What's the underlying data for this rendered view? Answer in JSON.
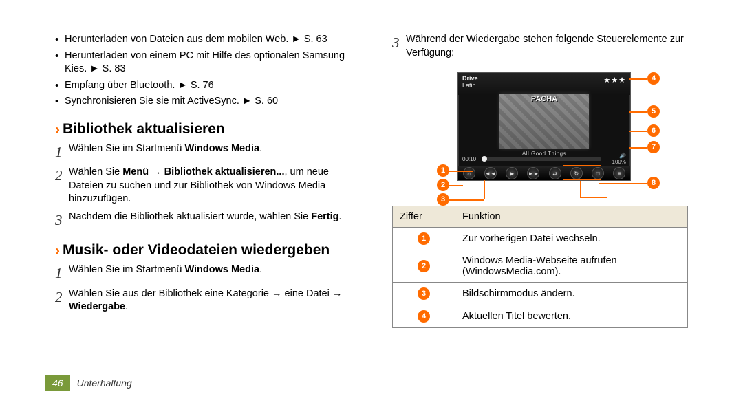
{
  "left": {
    "bullets": [
      {
        "pre": "Herunterladen von Dateien aus dem mobilen Web. ► ",
        "ref": "S. 63"
      },
      {
        "pre": "Herunterladen von einem PC mit Hilfe des optionalen Samsung Kies. ► ",
        "ref": "S. 83"
      },
      {
        "pre": "Empfang über Bluetooth. ► ",
        "ref": "S. 76"
      },
      {
        "pre": "Synchronisieren Sie sie mit ActiveSync. ► ",
        "ref": "S. 60"
      }
    ],
    "heading1": "Bibliothek aktualisieren",
    "steps1": [
      {
        "n": "1",
        "pre": "Wählen Sie im Startmenü ",
        "b1": "Windows Media",
        "post": "."
      },
      {
        "n": "2",
        "pre": "Wählen Sie ",
        "b1": "Menü",
        "mid": " → ",
        "b2": "Bibliothek aktualisieren...",
        "post": ", um neue Dateien zu suchen und zur Bibliothek von Windows Media hinzuzufügen."
      },
      {
        "n": "3",
        "pre": "Nachdem die Bibliothek aktualisiert wurde, wählen Sie ",
        "b1": "Fertig",
        "post": "."
      }
    ],
    "heading2": "Musik- oder Videodateien wiedergeben",
    "steps2": [
      {
        "n": "1",
        "pre": "Wählen Sie im Startmenü ",
        "b1": "Windows Media",
        "post": "."
      },
      {
        "n": "2",
        "pre": "Wählen Sie aus der Bibliothek eine Kategorie → eine Datei → ",
        "b1": "Wiedergabe",
        "post": "."
      }
    ]
  },
  "right": {
    "intro_n": "3",
    "intro": "Während der Wiedergabe stehen folgende Steuerelemente zur Verfügung:",
    "shot": {
      "title_line1": "Drive",
      "title_line2": "Latin",
      "stars": "★★★",
      "album_brand": "PACHA",
      "track": "All Good Things",
      "time": "00:10",
      "vol": "100%"
    },
    "table": {
      "h1": "Ziffer",
      "h2": "Funktion",
      "rows": [
        {
          "n": "1",
          "f": "Zur vorherigen Datei wechseln."
        },
        {
          "n": "2",
          "f": "Windows Media-Webseite aufrufen (WindowsMedia.com)."
        },
        {
          "n": "3",
          "f": "Bildschirmmodus ändern."
        },
        {
          "n": "4",
          "f": "Aktuellen Titel bewerten."
        }
      ]
    }
  },
  "footer": {
    "page": "46",
    "section": "Unterhaltung"
  }
}
